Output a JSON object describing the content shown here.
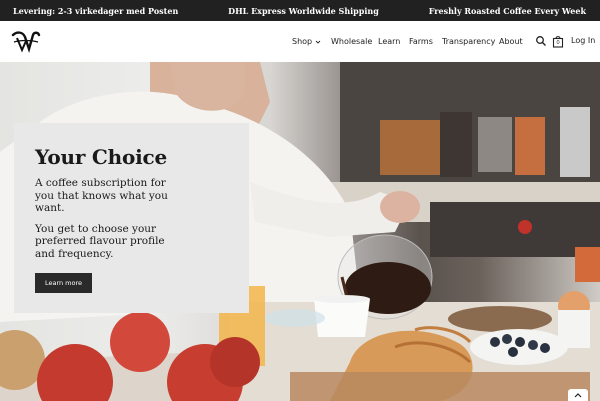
{
  "announcement": {
    "left": "Levering: 2-3 virkedager med Posten",
    "center": "DHL Express Worldwide Shipping",
    "right": "Freshly Roasted Coffee Every Week"
  },
  "header": {
    "logo_icon": "brand-logo-icon",
    "nav": [
      {
        "label": "Shop",
        "has_dropdown": true
      },
      {
        "label": "Wholesale"
      },
      {
        "label": "Learn"
      },
      {
        "label": "Farms"
      },
      {
        "label": "Transparency"
      },
      {
        "label": "About"
      }
    ],
    "search_icon": "search-icon",
    "cart_icon": "cart-icon",
    "cart_count": "0",
    "login_label": "Log In"
  },
  "hero": {
    "title": "Your Choice",
    "paragraph1": "A coffee subscription for you that knows what you want.",
    "paragraph2": "You get to choose your preferred flavour profile and frequency.",
    "button_label": "Learn more"
  },
  "colors": {
    "announcement_bg": "#212121",
    "card_bg": "#e9e8e8",
    "button_bg": "#2a2a2a"
  }
}
